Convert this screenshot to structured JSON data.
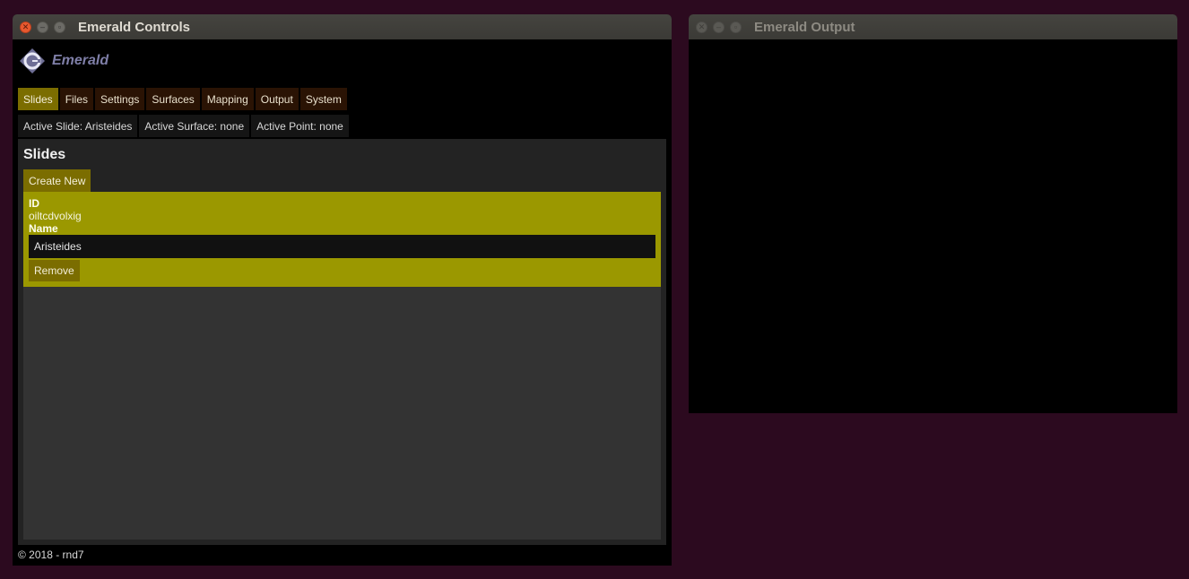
{
  "controls_window": {
    "title": "Emerald Controls",
    "brand": "Emerald",
    "tabs": [
      {
        "label": "Slides"
      },
      {
        "label": "Files"
      },
      {
        "label": "Settings"
      },
      {
        "label": "Surfaces"
      },
      {
        "label": "Mapping"
      },
      {
        "label": "Output"
      },
      {
        "label": "System"
      }
    ],
    "active_tab": "Slides",
    "status": {
      "slide": "Active Slide: Aristeides",
      "surface": "Active Surface: none",
      "point": "Active Point: none"
    },
    "panel": {
      "title": "Slides",
      "create_label": "Create New",
      "slide": {
        "id_label": "ID",
        "id_value": "oiltcdvolxig",
        "name_label": "Name",
        "name_value": "Aristeides",
        "remove_label": "Remove"
      }
    },
    "footer": "© 2018 - rnd7"
  },
  "output_window": {
    "title": "Emerald Output"
  },
  "colors": {
    "desktop": "#2c0a1f",
    "accent": "#7b6d00",
    "card": "#9b9800",
    "brand": "#7f7fa8"
  }
}
